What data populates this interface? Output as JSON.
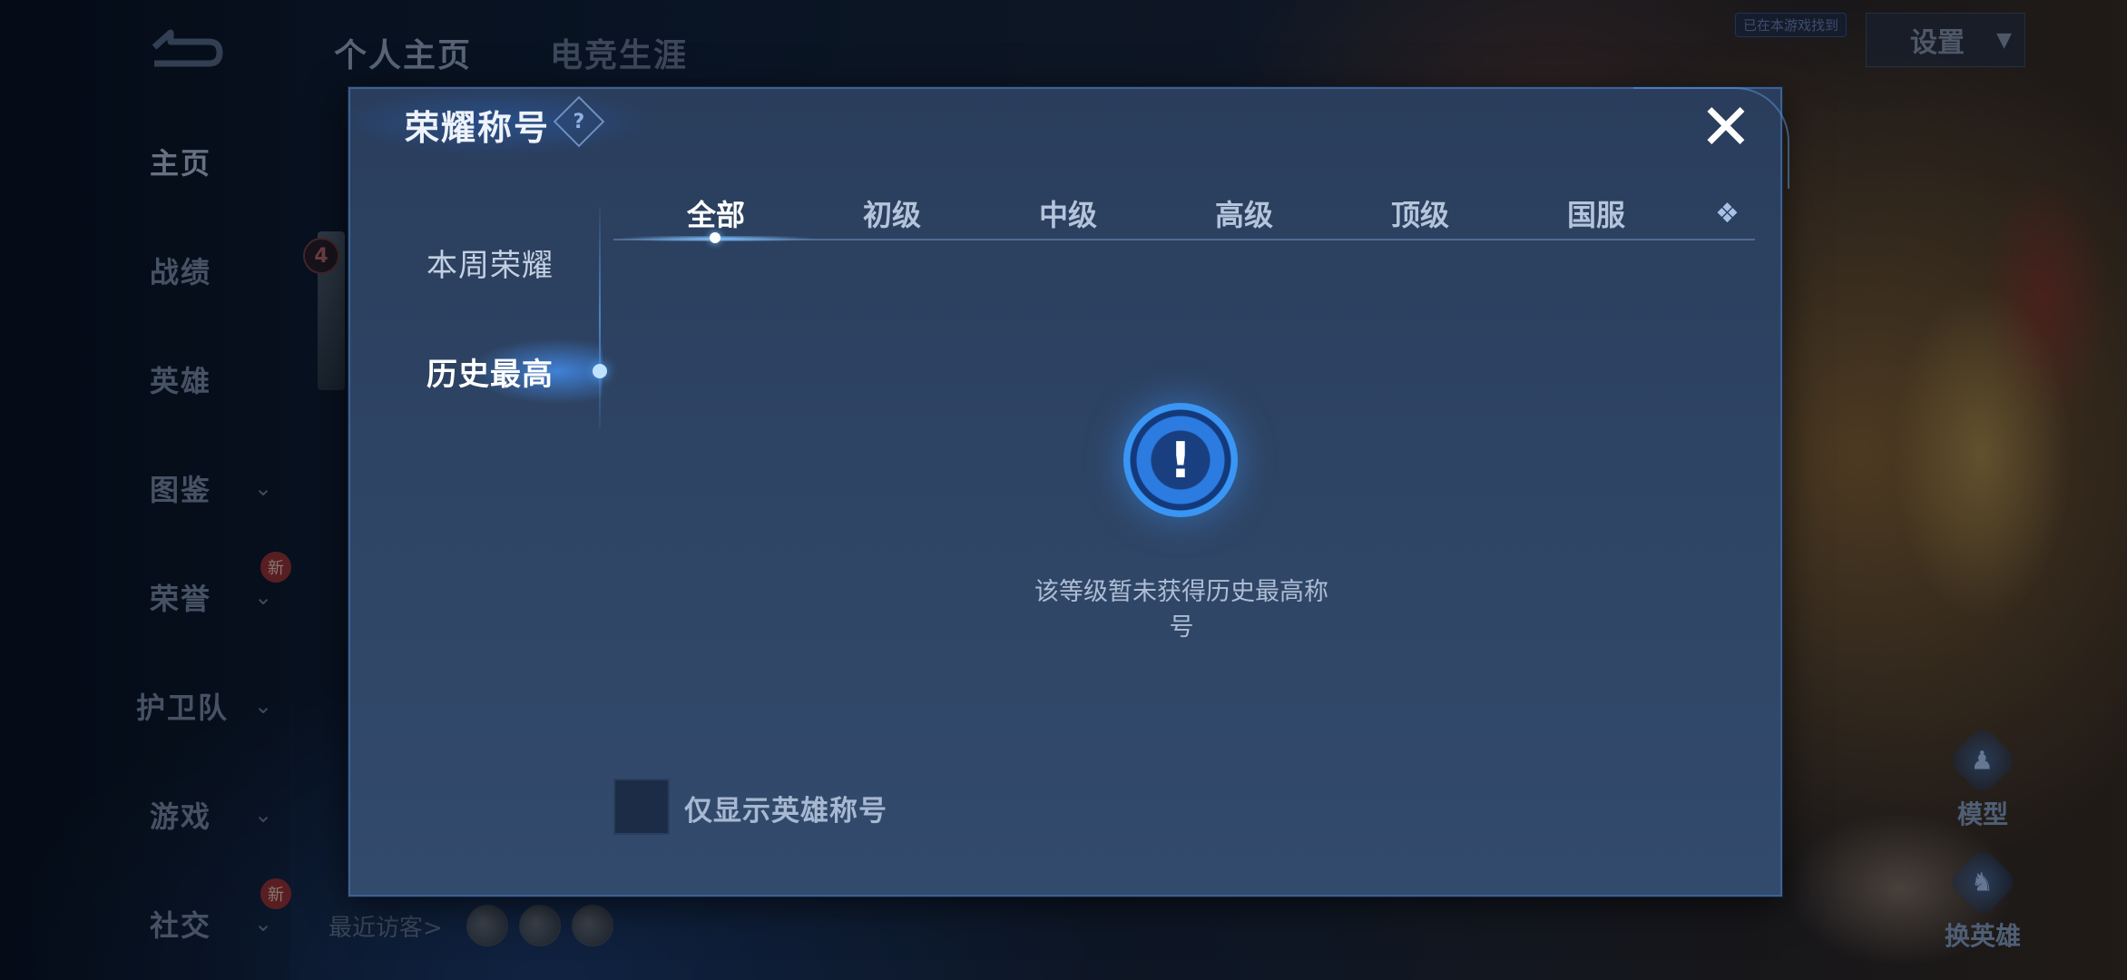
{
  "nav": {
    "back_icon": "back-arrow-icon",
    "items": [
      {
        "label": "主页",
        "active": true
      },
      {
        "label": "战绩"
      },
      {
        "label": "英雄"
      },
      {
        "label": "图鉴",
        "chevron": "chevron-down-icon"
      },
      {
        "label": "荣誉",
        "chevron": "chevron-down-icon",
        "badge": "新"
      },
      {
        "label": "护卫队",
        "chevron": "chevron-down-icon"
      },
      {
        "label": "游戏",
        "chevron": "chevron-down-icon"
      },
      {
        "label": "社交",
        "chevron": "chevron-down-icon",
        "badge": "新"
      }
    ]
  },
  "header": {
    "tabs": [
      "个人主页",
      "电竞生涯"
    ],
    "tag_small": "已在本游戏找到",
    "settings_label": "设置"
  },
  "background": {
    "badge_number": "4",
    "visitors_label": "最近访客>",
    "right_buttons": [
      "模型",
      "换英雄"
    ]
  },
  "modal": {
    "title": "荣耀称号",
    "help_icon": "question-icon",
    "close_icon": "close-icon",
    "side_tabs": [
      {
        "label": "本周荣耀"
      },
      {
        "label": "历史最高",
        "active": true
      }
    ],
    "grade_tabs": [
      {
        "label": "全部",
        "active": true
      },
      {
        "label": "初级"
      },
      {
        "label": "中级"
      },
      {
        "label": "高级"
      },
      {
        "label": "顶级"
      },
      {
        "label": "国服"
      }
    ],
    "more_tab_icon": "diamond-icon",
    "empty_icon": "exclamation-icon",
    "empty_text": "该等级暂未获得历史最高称号",
    "checkbox_label": "仅显示英雄称号",
    "checkbox_checked": false
  }
}
